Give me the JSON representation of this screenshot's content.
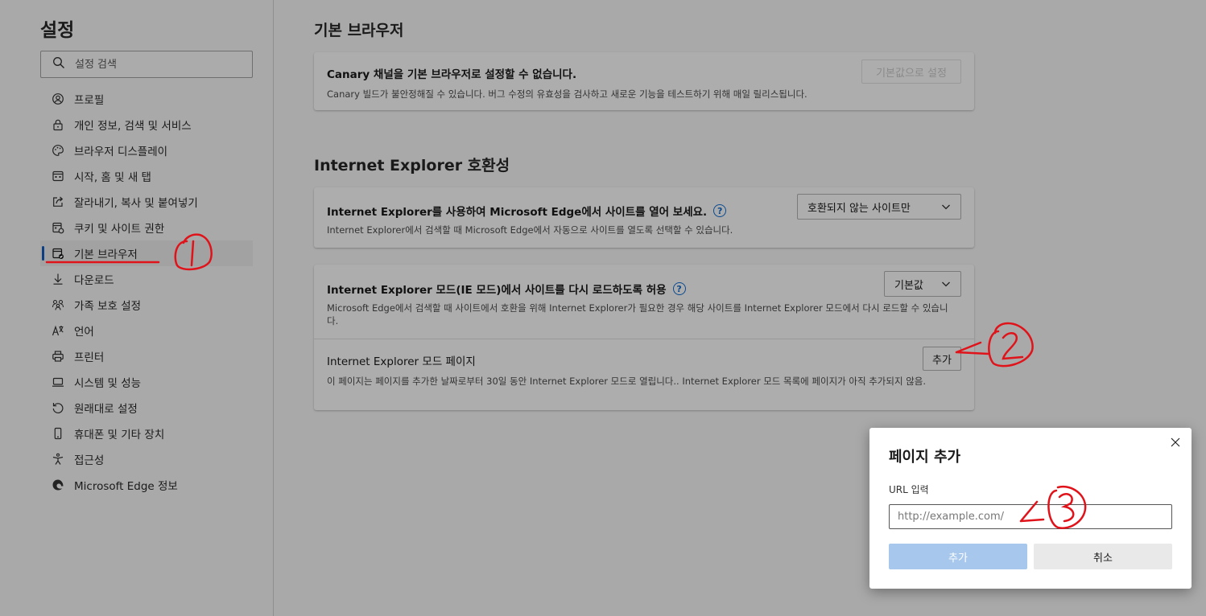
{
  "sidebar": {
    "title": "설정",
    "search_placeholder": "설정 검색",
    "items": [
      {
        "label": "프로필",
        "icon": "profile-icon"
      },
      {
        "label": "개인 정보, 검색 및 서비스",
        "icon": "lock-icon"
      },
      {
        "label": "브라우저 디스플레이",
        "icon": "palette-icon"
      },
      {
        "label": "시작, 홈 및 새 탭",
        "icon": "tab-grid-icon"
      },
      {
        "label": "잘라내기, 복사 및 붙여넣기",
        "icon": "share-icon"
      },
      {
        "label": "쿠키 및 사이트 권한",
        "icon": "site-permissions-icon"
      },
      {
        "label": "기본 브라우저",
        "icon": "default-browser-icon",
        "active": true
      },
      {
        "label": "다운로드",
        "icon": "download-icon"
      },
      {
        "label": "가족 보호 설정",
        "icon": "family-icon"
      },
      {
        "label": "언어",
        "icon": "language-icon"
      },
      {
        "label": "프린터",
        "icon": "printer-icon"
      },
      {
        "label": "시스템 및 성능",
        "icon": "laptop-icon"
      },
      {
        "label": "원래대로 설정",
        "icon": "reset-icon"
      },
      {
        "label": "휴대폰 및 기타 장치",
        "icon": "phone-icon"
      },
      {
        "label": "접근성",
        "icon": "accessibility-icon"
      },
      {
        "label": "Microsoft Edge 정보",
        "icon": "edge-logo-icon"
      }
    ]
  },
  "default_browser": {
    "title": "기본 브라우저",
    "row_title": "Canary 채널을 기본 브라우저로 설정할 수 없습니다.",
    "row_desc": "Canary 빌드가 불안정해질 수 있습니다. 버그 수정의 유효성을 검사하고 새로운 기능을 테스트하기 위해 매일 릴리스됩니다.",
    "button": "기본값으로 설정"
  },
  "ie_compat": {
    "title": "Internet Explorer 호환성",
    "open_row": {
      "title": "Internet Explorer를 사용하여 Microsoft Edge에서 사이트를 열어 보세요.",
      "desc": "Internet Explorer에서 검색할 때 Microsoft Edge에서 자동으로 사이트를 열도록 선택할 수 있습니다.",
      "dropdown": "호환되지 않는 사이트만"
    },
    "reload_row": {
      "title": "Internet Explorer 모드(IE 모드)에서 사이트를 다시 로드하도록 허용",
      "desc": "Microsoft Edge에서 검색할 때 사이트에서 호환을 위해 Internet Explorer가 필요한 경우 해당 사이트를 Internet Explorer 모드에서 다시 로드할 수 있습니다.",
      "dropdown": "기본값"
    },
    "pages_row": {
      "title": "Internet Explorer 모드 페이지",
      "desc": "이 페이지는 페이지를 추가한 날짜로부터 30일 동안 Internet Explorer 모드로 열립니다.. Internet Explorer 모드 목록에 페이지가 아직 추가되지 않음.",
      "button": "추가"
    }
  },
  "dialog": {
    "title": "페이지 추가",
    "label": "URL 입력",
    "placeholder": "http://example.com/",
    "add": "추가",
    "cancel": "취소"
  },
  "colors": {
    "accent": "#0b3f82",
    "annotation": "#e0131a",
    "primary_disabled": "#a7c8ec"
  }
}
